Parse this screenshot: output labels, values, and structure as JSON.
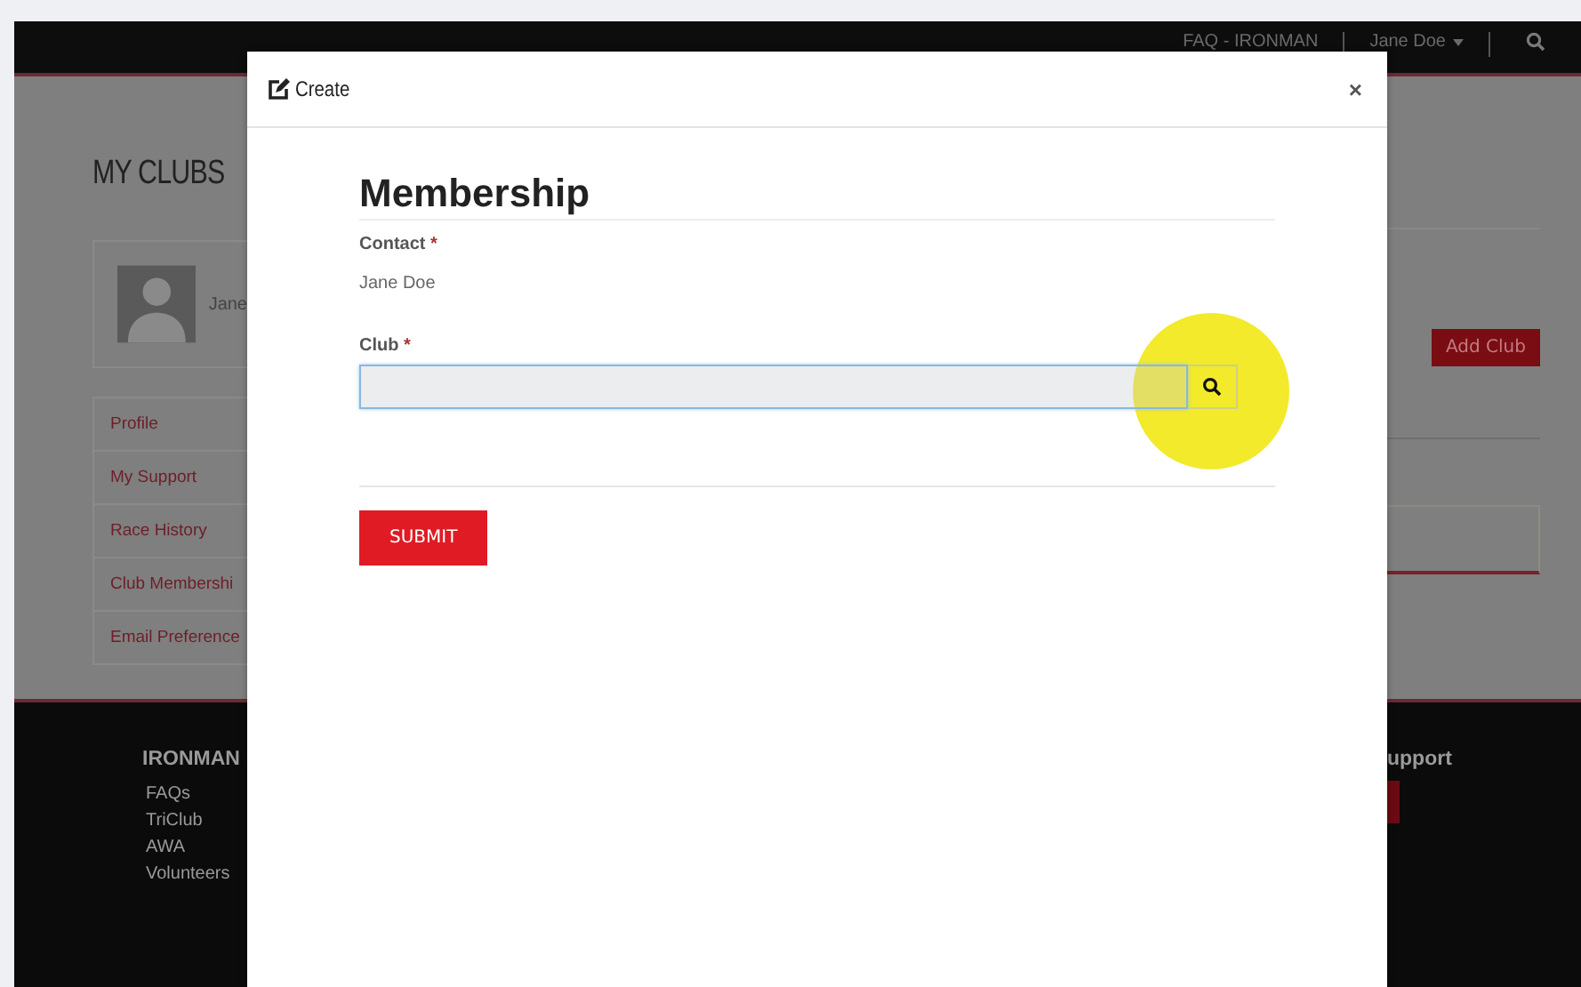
{
  "top_bar": {
    "links": [
      {
        "label": "FAQ - IRONMAN",
        "has_menu": false
      },
      {
        "label": "Jane Doe",
        "has_menu": true
      }
    ]
  },
  "background_page": {
    "heading": "MY CLUBS",
    "profile": {
      "name": "Jane"
    },
    "menu": [
      "Profile",
      "My Support",
      "Race History",
      "Club Membershi",
      "Email Preference"
    ],
    "add_button": "Add Club"
  },
  "footer": {
    "columns": [
      {
        "title": "IRONMAN",
        "links": [
          "FAQs",
          "TriClub",
          "AWA",
          "Volunteers"
        ]
      },
      {
        "title": "upport"
      }
    ]
  },
  "modal": {
    "title": "Create",
    "close": "×",
    "form_title": "Membership",
    "fields": [
      {
        "kind": "text",
        "label": "Contact",
        "required_mark": "*",
        "value": "Jane Doe"
      },
      {
        "kind": "lookup",
        "label": "Club",
        "required_mark": "*"
      }
    ],
    "submit": "SUBMIT"
  }
}
